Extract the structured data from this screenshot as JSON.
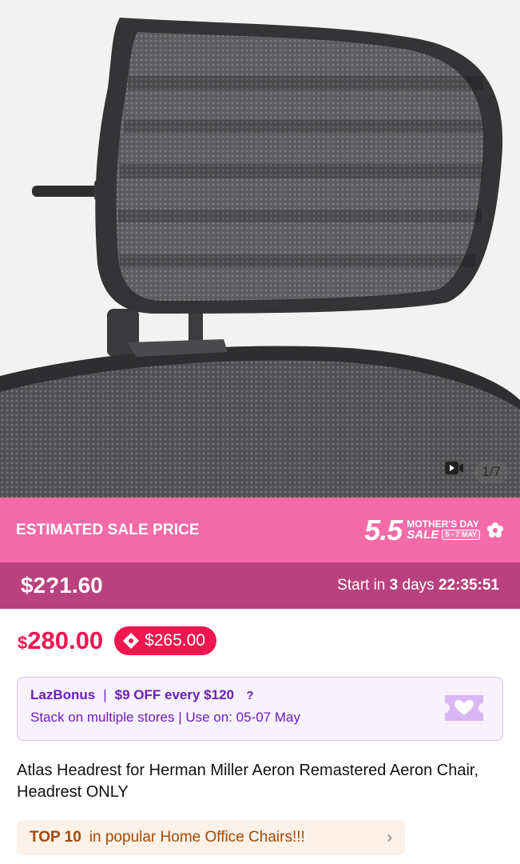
{
  "gallery": {
    "image_alt": "Atlas Headrest product image",
    "counter": "1/7",
    "video_icon": "video-play-icon"
  },
  "sale_banner": {
    "label": "ESTIMATED SALE PRICE",
    "event_number": "5.5",
    "event_top": "MOTHER'S DAY",
    "event_sale": "SALE",
    "event_dates": "5 - 7 MAY",
    "estimated_price": "$2?1.60",
    "countdown_prefix": "Start in",
    "countdown_days": "3",
    "countdown_days_label": "days",
    "countdown_time": "22:35:51",
    "colors": {
      "band": "#f56aa8",
      "price_band": "#b8417e"
    }
  },
  "price": {
    "currency": "$",
    "amount": "280.00",
    "voucher_price": "$265.00",
    "color": "#f0164f"
  },
  "lazbonus": {
    "name": "LazBonus",
    "offer": "$9 OFF every $120",
    "help": "?",
    "details": "Stack on multiple stores | Use on: 05-07 May",
    "color": "#6a1eb9"
  },
  "product": {
    "title": "Atlas Headrest for Herman Miller Aeron Remastered Aeron Chair, Headrest ONLY"
  },
  "ranking": {
    "label": "TOP 10",
    "text": "in popular Home Office Chairs!!!",
    "chevron": "›"
  }
}
